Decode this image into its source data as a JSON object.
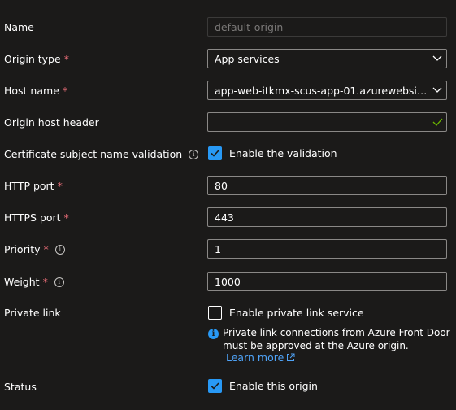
{
  "form": {
    "name": {
      "label": "Name",
      "value": "default-origin"
    },
    "origin_type": {
      "label": "Origin type",
      "required_mark": "*",
      "value": "App services"
    },
    "host_name": {
      "label": "Host name",
      "required_mark": "*",
      "value": "app-web-itkmx-scus-app-01.azurewebsite..."
    },
    "origin_host_header": {
      "label": "Origin host header",
      "value": ""
    },
    "cert_validation": {
      "label": "Certificate subject name validation",
      "checkbox_label": "Enable the validation",
      "checked": true
    },
    "http_port": {
      "label": "HTTP port",
      "required_mark": "*",
      "value": "80"
    },
    "https_port": {
      "label": "HTTPS port",
      "required_mark": "*",
      "value": "443"
    },
    "priority": {
      "label": "Priority",
      "required_mark": "*",
      "value": "1"
    },
    "weight": {
      "label": "Weight",
      "required_mark": "*",
      "value": "1000"
    },
    "private_link": {
      "label": "Private link",
      "checkbox_label": "Enable private link service",
      "checked": false,
      "info_text": "Private link connections from Azure Front Door must be approved at the Azure origin.",
      "learn_more": "Learn more"
    },
    "status": {
      "label": "Status",
      "checkbox_label": "Enable this origin",
      "checked": true
    }
  },
  "colors": {
    "accent": "#2899f5",
    "required": "#f1707b",
    "valid": "#6bb700",
    "link": "#4fa3f7"
  }
}
